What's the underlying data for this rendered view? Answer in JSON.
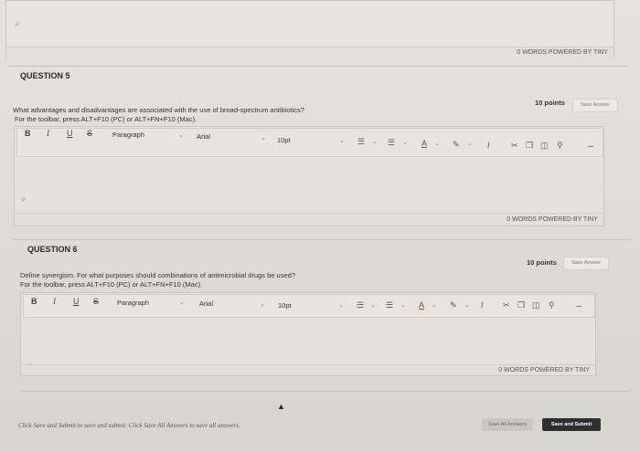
{
  "top_editor": {
    "paragraph_mark": "P",
    "status": "0 WORDS POWERED BY TINY"
  },
  "questions": [
    {
      "title": "QUESTION 5",
      "points": "10 points",
      "save_label": "Save Answer",
      "prompt": "What advantages and disadvantages are associated with the use of broad-spectrum antibiotics?",
      "instruction": "For the toolbar, press ALT+F10 (PC) or ALT+FN+F10 (Mac).",
      "paragraph_mark": "P",
      "status": "0 WORDS POWERED BY TINY"
    },
    {
      "title": "QUESTION 6",
      "points": "10 points",
      "save_label": "Save Answer",
      "prompt": "Define synergism. For what purposes should combinations of antimicrobial drugs be used?",
      "instruction": "For the toolbar, press ALT+F10 (PC) or ALT+FN+F10 (Mac).",
      "paragraph_mark": "P",
      "status": "0 WORDS POWERED BY TINY"
    }
  ],
  "toolbar": {
    "bold": "B",
    "italic": "I",
    "underline": "U",
    "strike": "S",
    "block_format": "Paragraph",
    "font_family": "Arial",
    "font_size": "10pt",
    "more": "..."
  },
  "footer": {
    "note": "Click Save and Submit to save and submit. Click Save All Answers to save all answers.",
    "save_all_label": "Save All Answers",
    "submit_label": "Save and Submit"
  },
  "icons": [
    "chevron-down-icon",
    "bullet-list-icon",
    "numbered-list-icon",
    "text-color-icon",
    "highlight-icon",
    "clear-format-icon",
    "cut-icon",
    "copy-icon",
    "paste-icon",
    "search-icon"
  ]
}
